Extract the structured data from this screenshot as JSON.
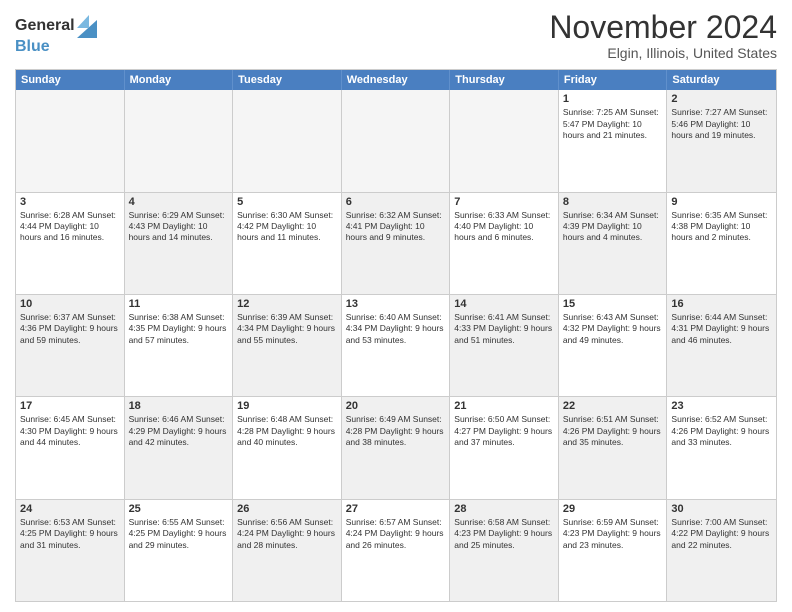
{
  "logo": {
    "general": "General",
    "blue": "Blue"
  },
  "header": {
    "title": "November 2024",
    "location": "Elgin, Illinois, United States"
  },
  "days": [
    "Sunday",
    "Monday",
    "Tuesday",
    "Wednesday",
    "Thursday",
    "Friday",
    "Saturday"
  ],
  "rows": [
    [
      {
        "day": "",
        "info": "",
        "empty": true
      },
      {
        "day": "",
        "info": "",
        "empty": true
      },
      {
        "day": "",
        "info": "",
        "empty": true
      },
      {
        "day": "",
        "info": "",
        "empty": true
      },
      {
        "day": "",
        "info": "",
        "empty": true
      },
      {
        "day": "1",
        "info": "Sunrise: 7:25 AM\nSunset: 5:47 PM\nDaylight: 10 hours\nand 21 minutes."
      },
      {
        "day": "2",
        "info": "Sunrise: 7:27 AM\nSunset: 5:46 PM\nDaylight: 10 hours\nand 19 minutes.",
        "shaded": true
      }
    ],
    [
      {
        "day": "3",
        "info": "Sunrise: 6:28 AM\nSunset: 4:44 PM\nDaylight: 10 hours\nand 16 minutes."
      },
      {
        "day": "4",
        "info": "Sunrise: 6:29 AM\nSunset: 4:43 PM\nDaylight: 10 hours\nand 14 minutes.",
        "shaded": true
      },
      {
        "day": "5",
        "info": "Sunrise: 6:30 AM\nSunset: 4:42 PM\nDaylight: 10 hours\nand 11 minutes."
      },
      {
        "day": "6",
        "info": "Sunrise: 6:32 AM\nSunset: 4:41 PM\nDaylight: 10 hours\nand 9 minutes.",
        "shaded": true
      },
      {
        "day": "7",
        "info": "Sunrise: 6:33 AM\nSunset: 4:40 PM\nDaylight: 10 hours\nand 6 minutes."
      },
      {
        "day": "8",
        "info": "Sunrise: 6:34 AM\nSunset: 4:39 PM\nDaylight: 10 hours\nand 4 minutes.",
        "shaded": true
      },
      {
        "day": "9",
        "info": "Sunrise: 6:35 AM\nSunset: 4:38 PM\nDaylight: 10 hours\nand 2 minutes."
      }
    ],
    [
      {
        "day": "10",
        "info": "Sunrise: 6:37 AM\nSunset: 4:36 PM\nDaylight: 9 hours\nand 59 minutes.",
        "shaded": true
      },
      {
        "day": "11",
        "info": "Sunrise: 6:38 AM\nSunset: 4:35 PM\nDaylight: 9 hours\nand 57 minutes."
      },
      {
        "day": "12",
        "info": "Sunrise: 6:39 AM\nSunset: 4:34 PM\nDaylight: 9 hours\nand 55 minutes.",
        "shaded": true
      },
      {
        "day": "13",
        "info": "Sunrise: 6:40 AM\nSunset: 4:34 PM\nDaylight: 9 hours\nand 53 minutes."
      },
      {
        "day": "14",
        "info": "Sunrise: 6:41 AM\nSunset: 4:33 PM\nDaylight: 9 hours\nand 51 minutes.",
        "shaded": true
      },
      {
        "day": "15",
        "info": "Sunrise: 6:43 AM\nSunset: 4:32 PM\nDaylight: 9 hours\nand 49 minutes."
      },
      {
        "day": "16",
        "info": "Sunrise: 6:44 AM\nSunset: 4:31 PM\nDaylight: 9 hours\nand 46 minutes.",
        "shaded": true
      }
    ],
    [
      {
        "day": "17",
        "info": "Sunrise: 6:45 AM\nSunset: 4:30 PM\nDaylight: 9 hours\nand 44 minutes."
      },
      {
        "day": "18",
        "info": "Sunrise: 6:46 AM\nSunset: 4:29 PM\nDaylight: 9 hours\nand 42 minutes.",
        "shaded": true
      },
      {
        "day": "19",
        "info": "Sunrise: 6:48 AM\nSunset: 4:28 PM\nDaylight: 9 hours\nand 40 minutes."
      },
      {
        "day": "20",
        "info": "Sunrise: 6:49 AM\nSunset: 4:28 PM\nDaylight: 9 hours\nand 38 minutes.",
        "shaded": true
      },
      {
        "day": "21",
        "info": "Sunrise: 6:50 AM\nSunset: 4:27 PM\nDaylight: 9 hours\nand 37 minutes."
      },
      {
        "day": "22",
        "info": "Sunrise: 6:51 AM\nSunset: 4:26 PM\nDaylight: 9 hours\nand 35 minutes.",
        "shaded": true
      },
      {
        "day": "23",
        "info": "Sunrise: 6:52 AM\nSunset: 4:26 PM\nDaylight: 9 hours\nand 33 minutes."
      }
    ],
    [
      {
        "day": "24",
        "info": "Sunrise: 6:53 AM\nSunset: 4:25 PM\nDaylight: 9 hours\nand 31 minutes.",
        "shaded": true
      },
      {
        "day": "25",
        "info": "Sunrise: 6:55 AM\nSunset: 4:25 PM\nDaylight: 9 hours\nand 29 minutes."
      },
      {
        "day": "26",
        "info": "Sunrise: 6:56 AM\nSunset: 4:24 PM\nDaylight: 9 hours\nand 28 minutes.",
        "shaded": true
      },
      {
        "day": "27",
        "info": "Sunrise: 6:57 AM\nSunset: 4:24 PM\nDaylight: 9 hours\nand 26 minutes."
      },
      {
        "day": "28",
        "info": "Sunrise: 6:58 AM\nSunset: 4:23 PM\nDaylight: 9 hours\nand 25 minutes.",
        "shaded": true
      },
      {
        "day": "29",
        "info": "Sunrise: 6:59 AM\nSunset: 4:23 PM\nDaylight: 9 hours\nand 23 minutes."
      },
      {
        "day": "30",
        "info": "Sunrise: 7:00 AM\nSunset: 4:22 PM\nDaylight: 9 hours\nand 22 minutes.",
        "shaded": true
      }
    ]
  ]
}
